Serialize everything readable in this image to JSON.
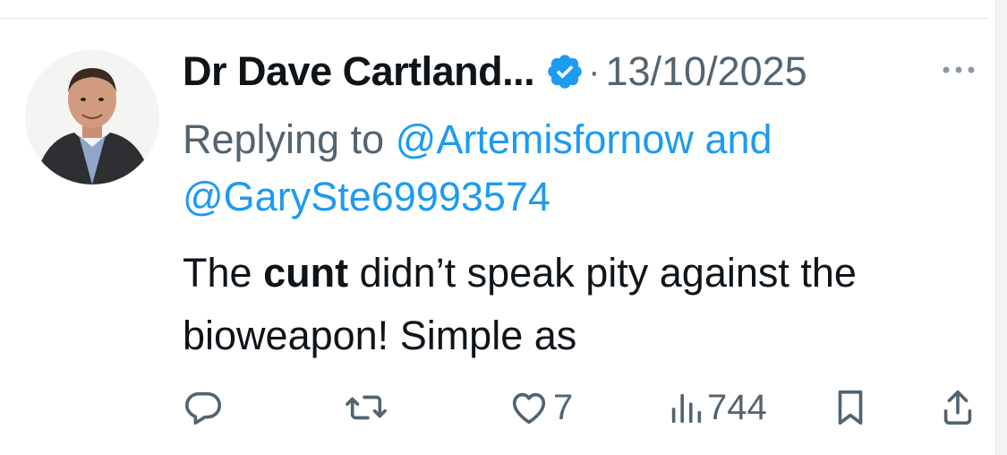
{
  "tweet": {
    "display_name": "Dr Dave Cartland...",
    "date": "13/10/2025",
    "separator": "·",
    "replying_prefix": "Replying to",
    "mention_1": "@Artemisfornow",
    "and_word": "and",
    "mention_2": "@GarySte69993574",
    "text_part_1": "The",
    "text_bold": "cunt",
    "text_part_2": "didn’t speak pity against the bioweapon! Simple as"
  },
  "actions": {
    "like_count": "7",
    "views_count": "744"
  },
  "icons": {
    "verified": "verified-badge-icon",
    "more": "more-dots-icon",
    "reply": "reply-icon",
    "retweet": "retweet-icon",
    "like": "heart-icon",
    "views": "views-chart-icon",
    "bookmark": "bookmark-icon",
    "share": "share-icon"
  },
  "colors": {
    "accent": "#1d9bf0",
    "secondary_text": "#536471",
    "primary_text": "#0f1419"
  }
}
